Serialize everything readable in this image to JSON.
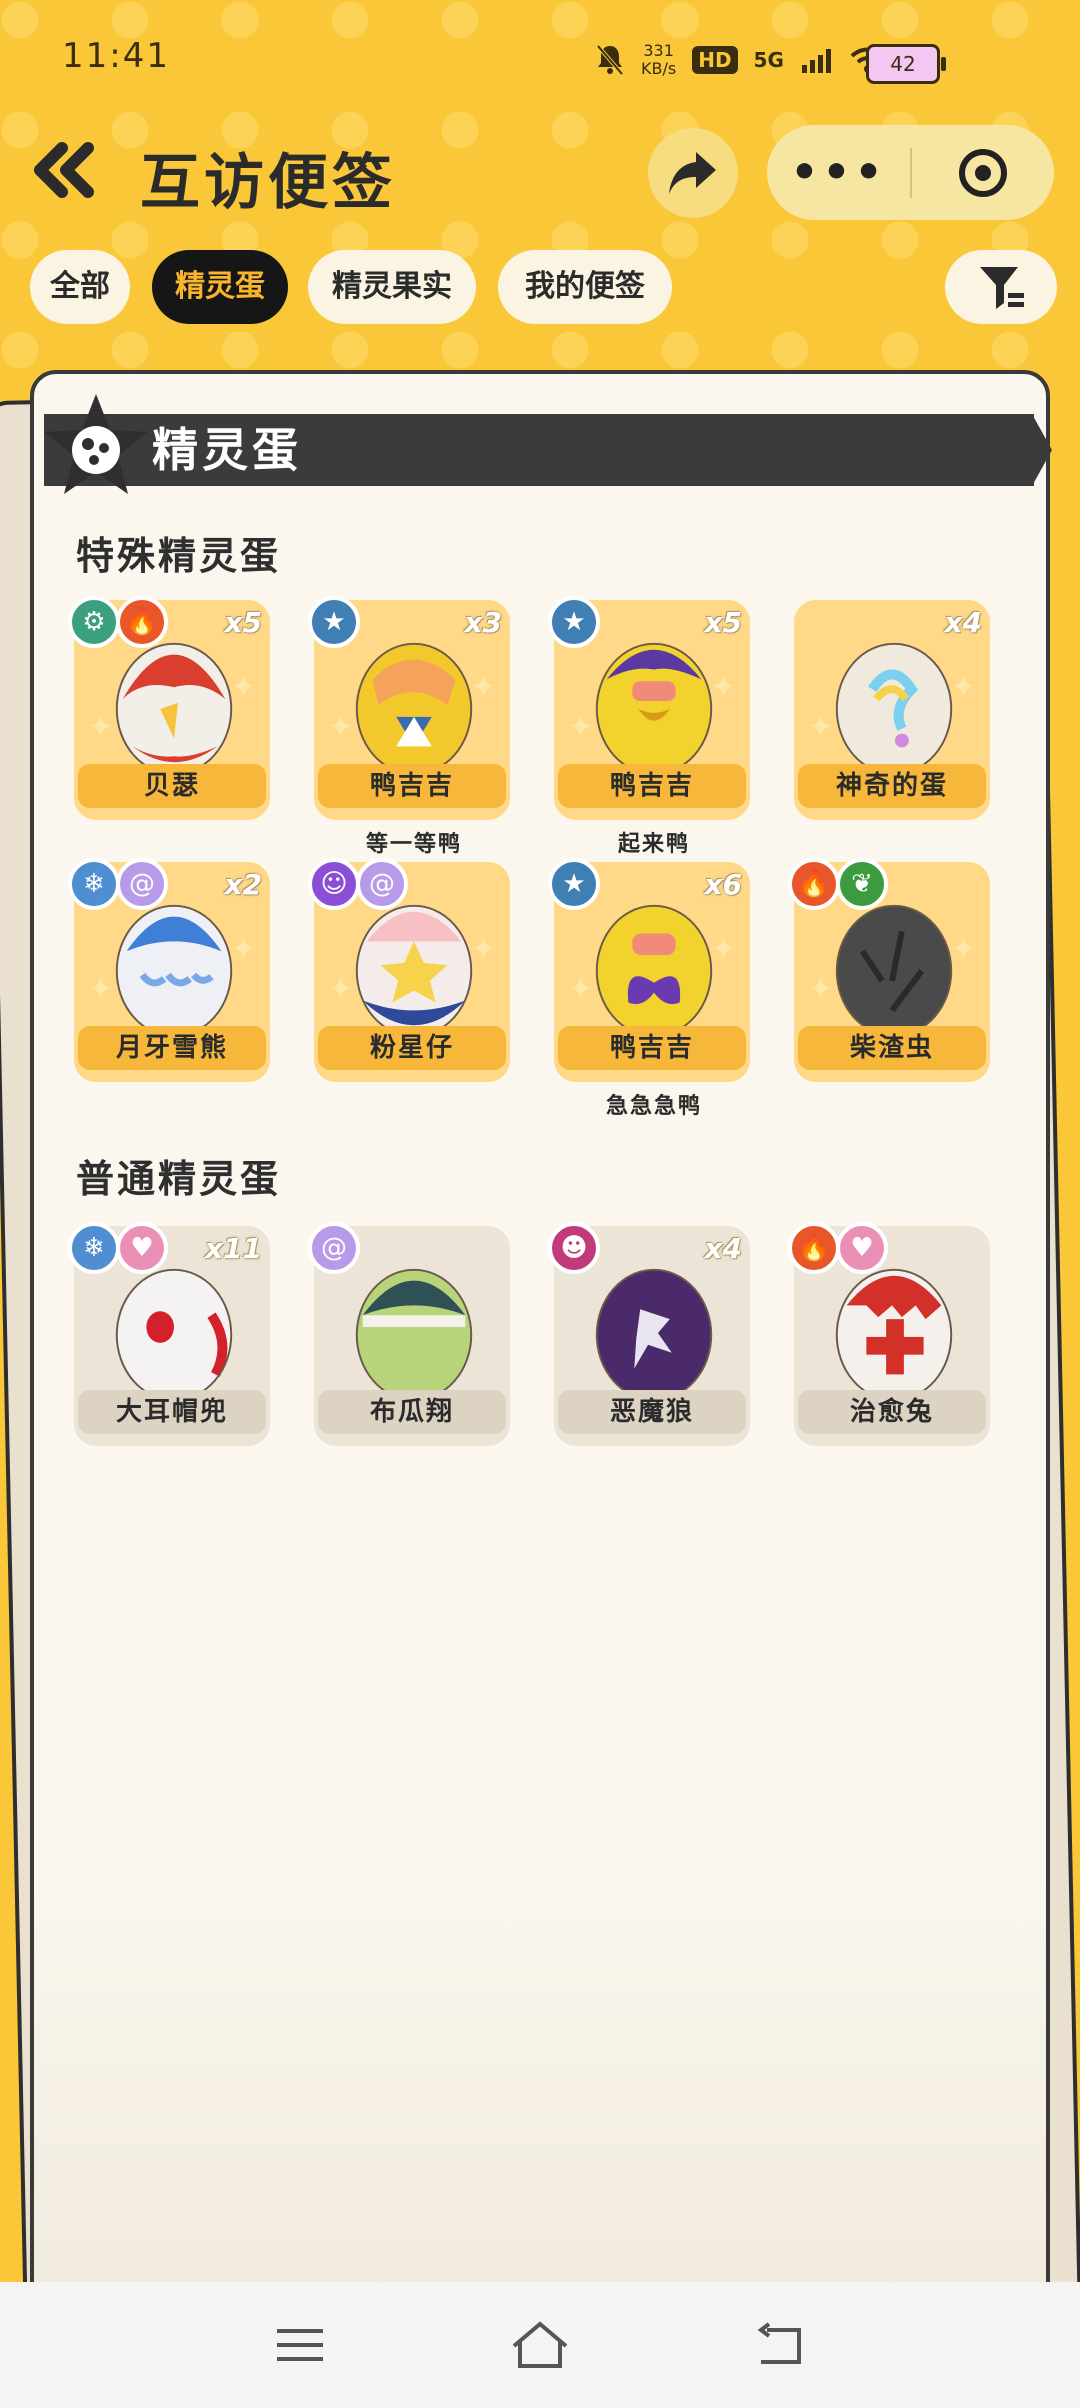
{
  "status_bar": {
    "time": "11:41",
    "net_speed": "331",
    "net_unit": "KB/s",
    "hd": "HD",
    "signal": "5G",
    "battery": "42"
  },
  "header": {
    "title": "互访便签"
  },
  "tabs": [
    {
      "label": "全部",
      "active": false
    },
    {
      "label": "精灵蛋",
      "active": true
    },
    {
      "label": "精灵果实",
      "active": false
    },
    {
      "label": "我的便签",
      "active": false
    }
  ],
  "banner": {
    "title": "精灵蛋"
  },
  "special": {
    "heading": "特殊精灵蛋",
    "items": [
      {
        "name": "贝瑟",
        "count": "x5",
        "sub": "",
        "badges": [
          "green-gear",
          "fire"
        ],
        "egg": "red"
      },
      {
        "name": "鸭吉吉",
        "count": "x3",
        "sub": "等一等鸭",
        "badges": [
          "star"
        ],
        "egg": "yellow-ribbon"
      },
      {
        "name": "鸭吉吉",
        "count": "x5",
        "sub": "起来鸭",
        "badges": [
          "star"
        ],
        "egg": "yellow-purple"
      },
      {
        "name": "神奇的蛋",
        "count": "x4",
        "sub": "",
        "badges": [],
        "egg": "rainbow"
      },
      {
        "name": "月牙雪熊",
        "count": "x2",
        "sub": "",
        "badges": [
          "ice",
          "psychic"
        ],
        "egg": "blue-moon"
      },
      {
        "name": "粉星仔",
        "count": "",
        "sub": "",
        "badges": [
          "ghost",
          "psychic"
        ],
        "egg": "pink-star"
      },
      {
        "name": "鸭吉吉",
        "count": "x6",
        "sub": "急急急鸭",
        "badges": [
          "star"
        ],
        "egg": "yellow-butterfly"
      },
      {
        "name": "柴渣虫",
        "count": "",
        "sub": "",
        "badges": [
          "fire",
          "leaf"
        ],
        "egg": "dark"
      }
    ]
  },
  "normal": {
    "heading": "普通精灵蛋",
    "items": [
      {
        "name": "大耳帽兜",
        "count": "x11",
        "sub": "",
        "badges": [
          "ice",
          "heart"
        ],
        "egg": "white-red"
      },
      {
        "name": "布瓜翔",
        "count": "",
        "sub": "",
        "badges": [
          "psychic"
        ],
        "egg": "green"
      },
      {
        "name": "恶魔狼",
        "count": "x4",
        "sub": "",
        "badges": [
          "demon"
        ],
        "egg": "purple"
      },
      {
        "name": "治愈兔",
        "count": "",
        "sub": "",
        "badges": [
          "fire",
          "heart"
        ],
        "egg": "cross"
      }
    ]
  },
  "nav": {
    "menu": "menu-icon",
    "home": "home-icon",
    "back": "back-icon"
  }
}
